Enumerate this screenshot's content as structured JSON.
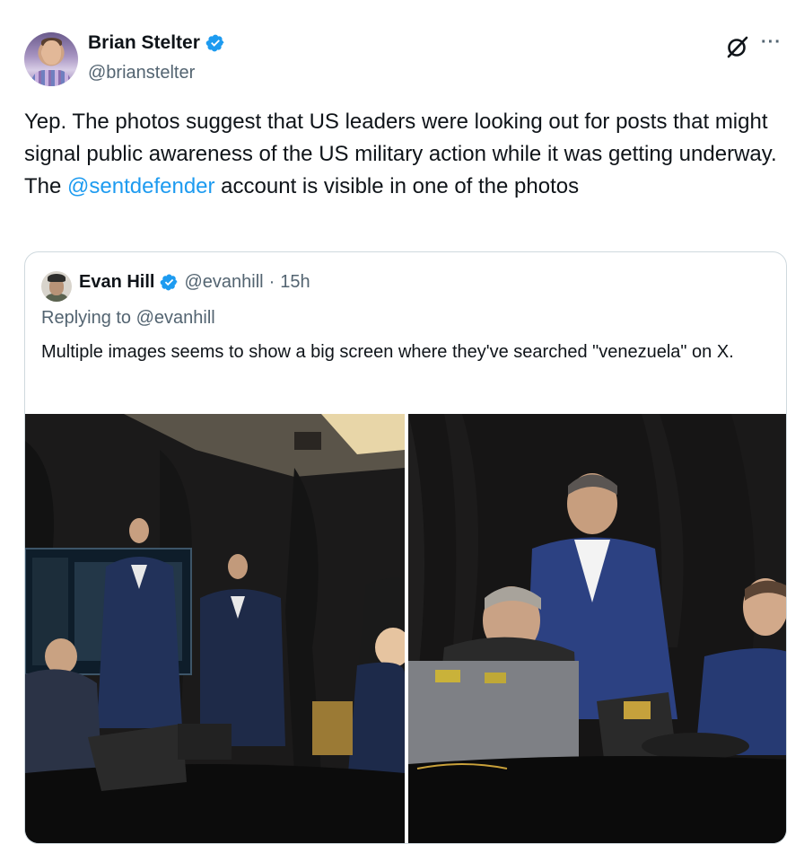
{
  "tweet": {
    "author": {
      "display_name": "Brian Stelter",
      "handle": "@brianstelter",
      "verified": true
    },
    "text_parts": {
      "before_mention": "Yep. The photos suggest that US leaders were looking out for posts that might signal public awareness of the US military action while it was getting underway. The ",
      "mention": "@sentdefender",
      "after_mention": " account is visible in one of the photos"
    },
    "icons": {
      "grok": "grok-icon",
      "more": "more-icon",
      "verified": "verified-badge-icon"
    }
  },
  "quote": {
    "author": {
      "display_name": "Evan Hill",
      "handle": "@evanhill",
      "separator": "·",
      "time": "15h",
      "verified": true
    },
    "replying_to": "Replying to @evanhill",
    "text": "Multiple images seems to show a big screen where they've searched \"venezuela\" on X.",
    "images": [
      {
        "name": "photo-1",
        "subject": "men in suits standing around a table watching a large screen"
      },
      {
        "name": "photo-2",
        "subject": "men at a table with laptops in a dark room"
      }
    ]
  },
  "colors": {
    "text": "#0f1419",
    "secondary": "#536471",
    "link": "#1d9bf0",
    "border": "#cfd9de"
  }
}
